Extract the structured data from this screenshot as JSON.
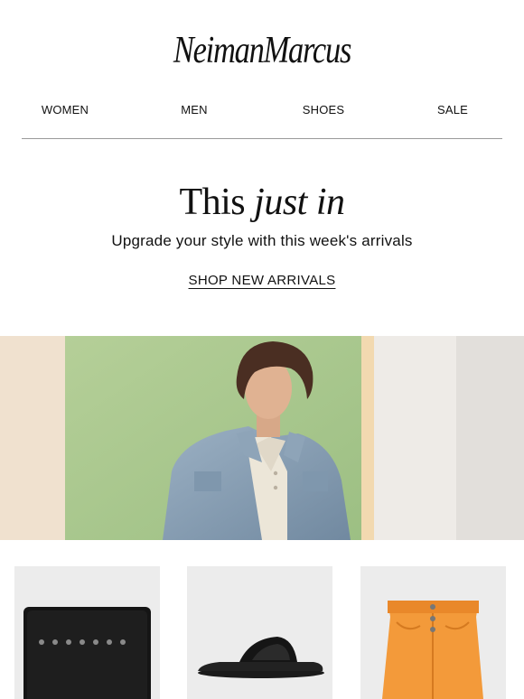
{
  "brand": {
    "logo_text": "NeimanMarcus"
  },
  "nav": {
    "items": [
      {
        "label": "WOMEN"
      },
      {
        "label": "MEN"
      },
      {
        "label": "SHOES"
      },
      {
        "label": "SALE"
      }
    ]
  },
  "hero": {
    "headline_regular": "This",
    "headline_italic": "just in",
    "subhead": "Upgrade your style with this week's arrivals",
    "cta_label": "SHOP NEW ARRIVALS"
  },
  "colors": {
    "text": "#111111",
    "tile_background": "#ececec",
    "wall_green": "#a6c48c",
    "skirt_orange": "#f39a3a",
    "jacket_blue": "#8aa2b8"
  },
  "products": [
    {
      "icon": "card-holder-icon"
    },
    {
      "icon": "slide-sandal-icon"
    },
    {
      "icon": "denim-skirt-icon"
    }
  ]
}
